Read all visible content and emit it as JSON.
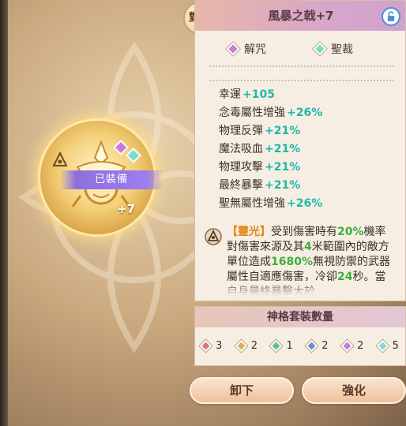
{
  "item": {
    "name": "風暴之戟+7",
    "equipped_label": "已裝備",
    "enhance_level": "+7"
  },
  "compare_label": "對比",
  "tabs": [
    {
      "label": "解咒",
      "color": "#c97ad9"
    },
    {
      "label": "聖裁",
      "color": "#7fd9c6"
    }
  ],
  "stats": [
    {
      "name": "幸運",
      "value": "+105"
    },
    {
      "name": "念毒屬性增強",
      "value": "+26%"
    },
    {
      "name": "物理反彈",
      "value": "+21%"
    },
    {
      "name": "魔法吸血",
      "value": "+21%"
    },
    {
      "name": "物理攻擊",
      "value": "+21%"
    },
    {
      "name": "最終暴擊",
      "value": "+21%"
    },
    {
      "name": "聖無屬性增強",
      "value": "+26%"
    }
  ],
  "description": {
    "skill_name": "【靈光】",
    "p1": "受到傷害時有",
    "v1": "20%",
    "p2": "機率對傷害來源及其",
    "v2": "4",
    "p3": "米範圍內的敵方單位造成",
    "v3": "1680%",
    "p4": "無視防禦的武器屬性自適應傷害，冷卻",
    "v4": "24",
    "p5": "秒。當自身最終暴擊大於"
  },
  "set_panel": {
    "title": "神格套裝數量",
    "items": [
      {
        "color": "#e0727a",
        "count": "3"
      },
      {
        "color": "#e2b24a",
        "count": "2"
      },
      {
        "color": "#5fbf8a",
        "count": "1"
      },
      {
        "color": "#6d8fc9",
        "count": "2"
      },
      {
        "color": "#c97ad9",
        "count": "2"
      },
      {
        "color": "#7fd9d6",
        "count": "5"
      }
    ]
  },
  "buttons": {
    "unequip": "卸下",
    "enhance": "強化"
  },
  "colors": {
    "stat_value": "#1fb8a8",
    "highlight_orange": "#e08b18",
    "highlight_green": "#3cae3c"
  }
}
